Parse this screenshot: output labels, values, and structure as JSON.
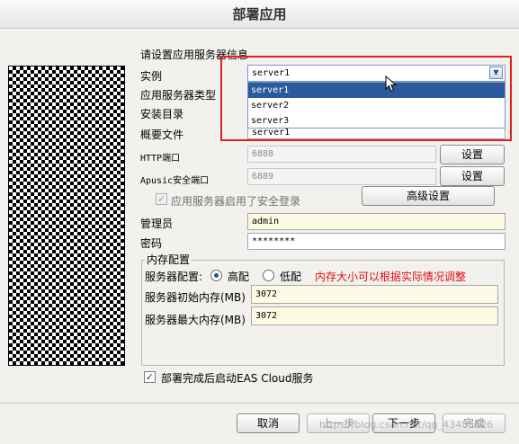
{
  "window": {
    "title": "部署应用"
  },
  "section_title": "请设置应用服务器信息",
  "labels": {
    "instance": "实例",
    "server_type": "应用服务器类型",
    "install_dir": "安装目录",
    "profile": "概要文件",
    "http_port": "HTTP端口",
    "apusic_port": "Apusic安全端口",
    "admin": "管理员",
    "password": "密码"
  },
  "instance_combo": {
    "value": "server1",
    "options": [
      "server1",
      "server2",
      "server3"
    ],
    "selected_index": 0
  },
  "profile_value": "server1",
  "http_port": {
    "value": "6888",
    "button": "设置"
  },
  "apusic_port": {
    "value": "6889",
    "button": "设置"
  },
  "secure_login": {
    "label": "应用服务器启用了安全登录",
    "checked": true
  },
  "advanced_button": "高级设置",
  "admin_value": "admin",
  "password_value": "********",
  "memory": {
    "group_title": "内存配置",
    "config_label": "服务器配置:",
    "high_label": "高配",
    "low_label": "低配",
    "selected": "高配",
    "note": "内存大小可以根据实际情况调整",
    "note_color": "#e01010",
    "initial_label": "服务器初始内存(MB)",
    "initial_value": "3072",
    "max_label": "服务器最大内存(MB)",
    "max_value": "3072"
  },
  "start_after": {
    "label": "部署完成后启动EAS Cloud服务",
    "checked": true
  },
  "buttons": {
    "cancel": "取消",
    "prev": "上一步",
    "next": "下一步",
    "finish": "完成"
  },
  "watermark": "https://blog.csdn.net/qq_43485626",
  "highlight_color": "#e02020"
}
